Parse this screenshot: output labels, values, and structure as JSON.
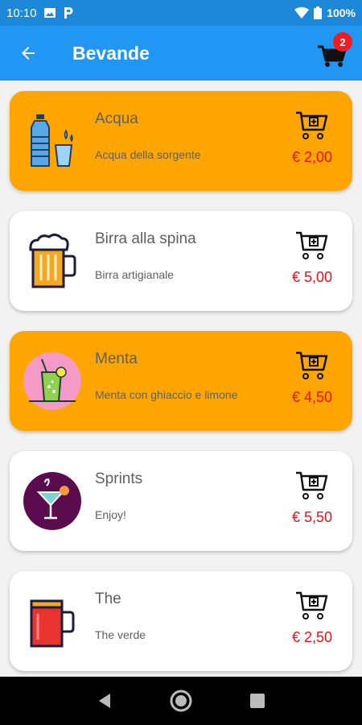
{
  "status_bar": {
    "time": "10:10",
    "battery": "100%"
  },
  "app_bar": {
    "title": "Bevande",
    "cart_count": "2"
  },
  "items": [
    {
      "name": "Acqua",
      "description": "Acqua della sorgente",
      "price": "€ 2,00"
    },
    {
      "name": "Birra alla spina",
      "description": "Birra artigianale",
      "price": "€ 5,00"
    },
    {
      "name": "Menta",
      "description": "Menta con ghiaccio e limone",
      "price": "€ 4,50"
    },
    {
      "name": "Sprints",
      "description": "Enjoy!",
      "price": "€ 5,50"
    },
    {
      "name": "The",
      "description": "The verde",
      "price": "€ 2,50"
    }
  ],
  "colors": {
    "app_bar": "#2196f3",
    "status_bar": "#1e88d8",
    "highlight": "#ffa500",
    "price": "#e8121a",
    "badge": "#ee1d23"
  },
  "icons": [
    "back-arrow-icon",
    "shopping-cart-icon",
    "add-to-cart-icon",
    "water-bottle-icon",
    "beer-mug-icon",
    "mint-drink-icon",
    "cocktail-icon",
    "tea-mug-icon",
    "nav-back-icon",
    "nav-home-icon",
    "nav-recents-icon"
  ]
}
